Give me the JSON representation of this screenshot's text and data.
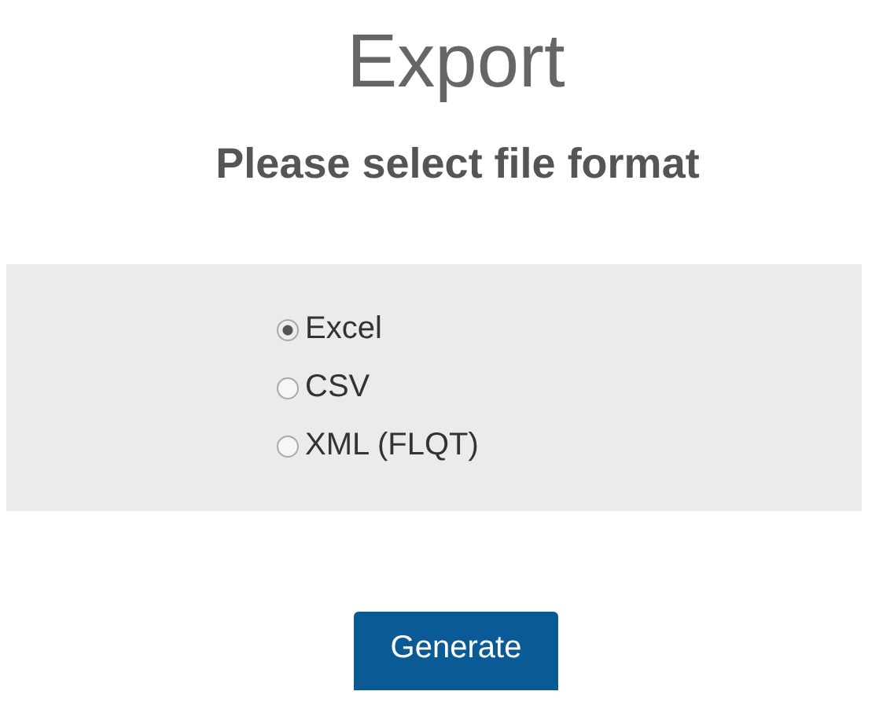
{
  "title": "Export",
  "subtitle": "Please select file format",
  "formats": [
    {
      "label": "Excel",
      "selected": true
    },
    {
      "label": "CSV",
      "selected": false
    },
    {
      "label": "XML (FLQT)",
      "selected": false
    }
  ],
  "button": "Generate"
}
